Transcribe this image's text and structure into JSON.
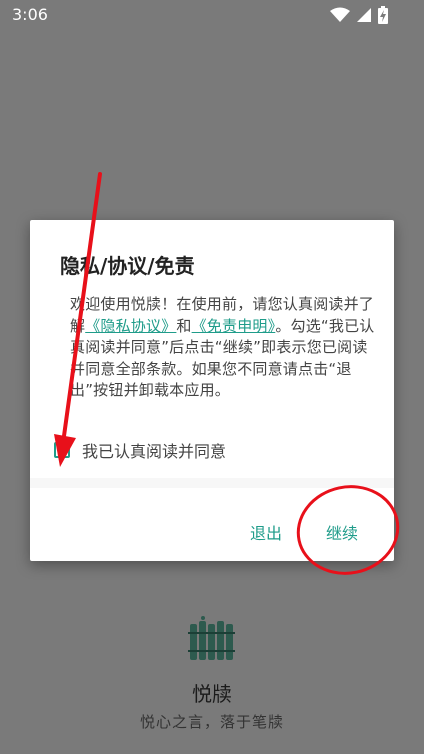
{
  "status_bar": {
    "time": "3:06",
    "icons": [
      "wifi-icon",
      "signal-icon",
      "battery-charging-icon"
    ]
  },
  "dialog": {
    "title": "隐私/协议/免责",
    "body_part1": "欢迎使用悦牍！在使用前，请您认真阅读并了解",
    "privacy_link": "《隐私协议》",
    "and_text": "和",
    "disclaimer_link": "《免责申明》",
    "body_part2": "。勾选“我已认真阅读并同意”后点击“继续”即表示您已阅读并同意全部条款。如果您不同意请点击“退出”按钮并卸载本应用。",
    "agree_label": "我已认真阅读并同意",
    "exit_label": "退出",
    "continue_label": "继续"
  },
  "app": {
    "name": "悦牍",
    "slogan": "悦心之言，落于笔牍",
    "logo_icon": "bamboo-slips-icon"
  },
  "colors": {
    "accent": "#1f9c8a",
    "overlay_bg": "#7a7a7a",
    "annotation_red": "#e8101a",
    "logo": "#2d5a4e"
  }
}
